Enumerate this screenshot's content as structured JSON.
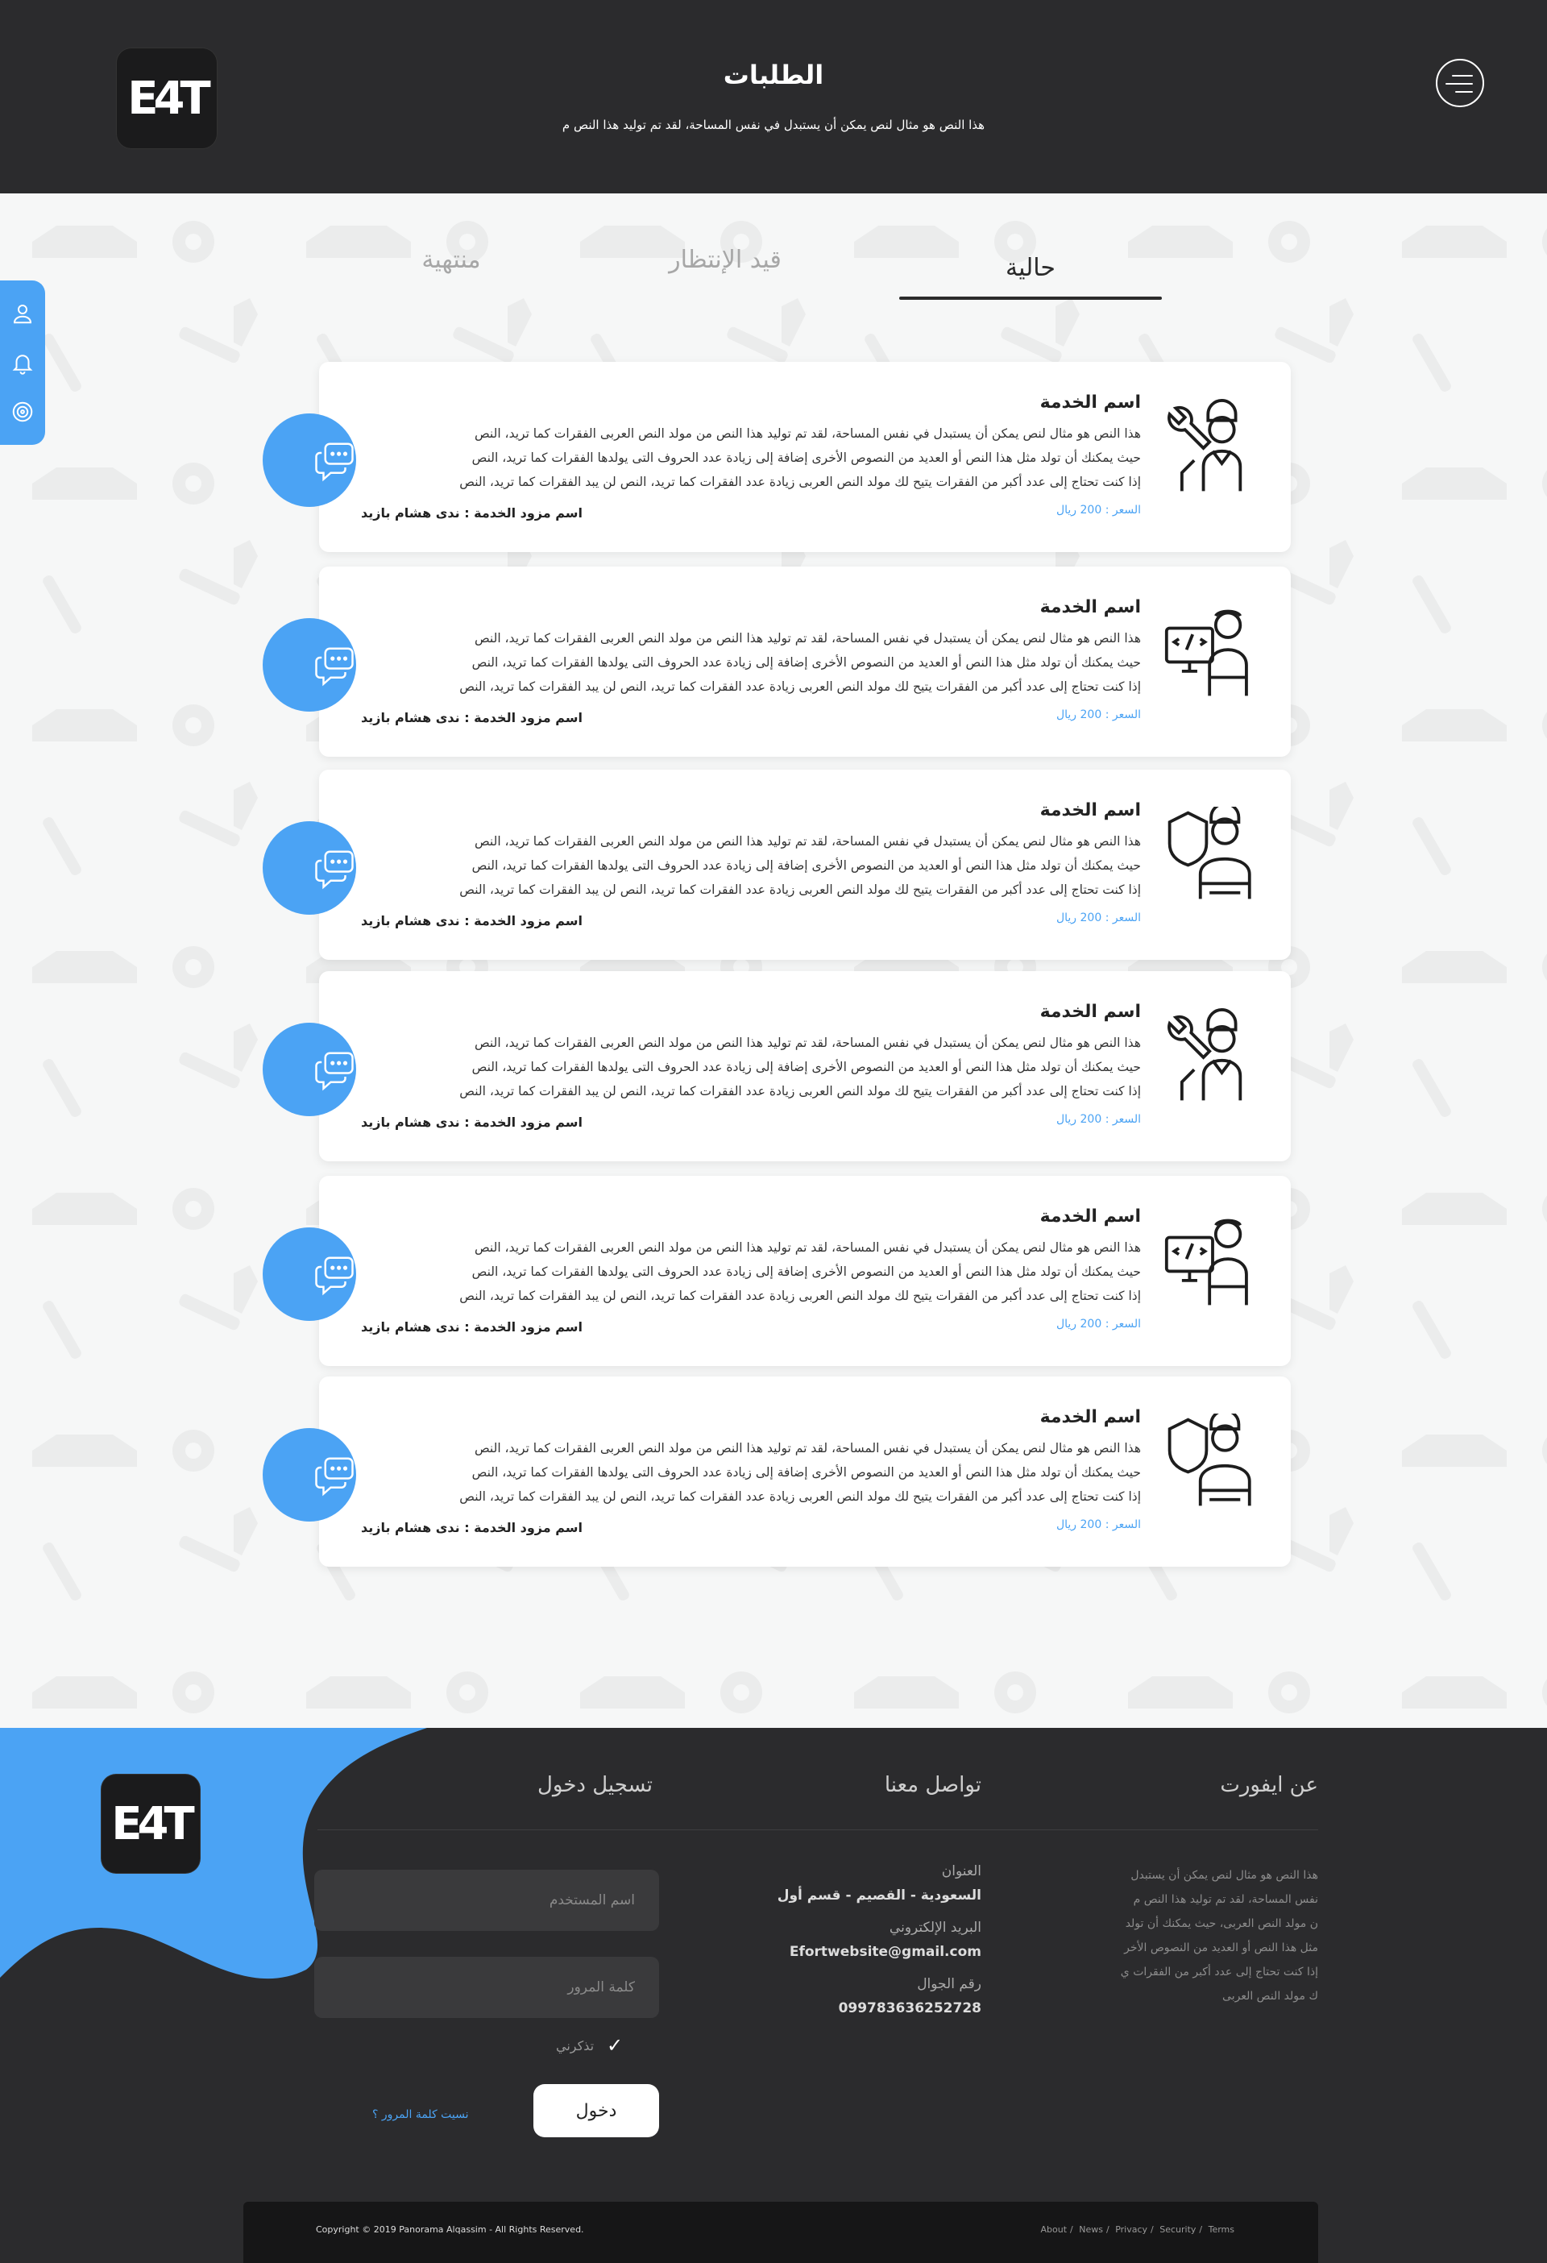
{
  "header": {
    "logo": "E4T",
    "title": "الطلبات",
    "subtitle": "هذا النص هو مثال لنص يمكن أن يستبدل في نفس المساحة، لقد تم توليد هذا النص م"
  },
  "tabs": {
    "current": "حالية",
    "pending": "قيد الإنتظار",
    "finished": "منتهية"
  },
  "orders": [
    {
      "service_name": "اسم الخدمة",
      "desc_1": "هذا النص هو مثال لنص يمكن أن يستبدل في نفس المساحة، لقد تم توليد هذا النص من مولد النص العربى  الفقرات كما تريد، النص",
      "desc_2": "حيث يمكنك أن تولد مثل هذا النص أو العديد من النصوص الأخرى إضافة إلى زيادة عدد الحروف التى يولدها  الفقرات كما تريد، النص",
      "desc_3": "إذا كنت تحتاج إلى عدد أكبر من الفقرات يتيح لك مولد النص العربى زيادة عدد الفقرات كما تريد، النص لن يبد  الفقرات كما تريد، النص",
      "price": "السعر : 200 ريال",
      "provider": "اسم مزود الخدمة : ندى هشام بازيد",
      "icon": "mechanic-icon"
    },
    {
      "service_name": "اسم الخدمة",
      "desc_1": "هذا النص هو مثال لنص يمكن أن يستبدل في نفس المساحة، لقد تم توليد هذا النص من مولد النص العربى  الفقرات كما تريد، النص",
      "desc_2": "حيث يمكنك أن تولد مثل هذا النص أو العديد من النصوص الأخرى إضافة إلى زيادة عدد الحروف التى يولدها  الفقرات كما تريد، النص",
      "desc_3": "إذا كنت تحتاج إلى عدد أكبر من الفقرات يتيح لك مولد النص العربى زيادة عدد الفقرات كما تريد، النص لن يبد  الفقرات كما تريد، النص",
      "price": "السعر : 200 ريال",
      "provider": "اسم مزود الخدمة : ندى هشام بازيد",
      "icon": "programmer-icon"
    },
    {
      "service_name": "اسم الخدمة",
      "desc_1": "هذا النص هو مثال لنص يمكن أن يستبدل في نفس المساحة، لقد تم توليد هذا النص من مولد النص العربى  الفقرات كما تريد، النص",
      "desc_2": "حيث يمكنك أن تولد مثل هذا النص أو العديد من النصوص الأخرى إضافة إلى زيادة عدد الحروف التى يولدها  الفقرات كما تريد، النص",
      "desc_3": "إذا كنت تحتاج إلى عدد أكبر من الفقرات يتيح لك مولد النص العربى زيادة عدد الفقرات كما تريد، النص لن يبد  الفقرات كما تريد، النص",
      "price": "السعر : 200 ريال",
      "provider": "اسم مزود الخدمة : ندى هشام بازيد",
      "icon": "security-worker-icon"
    },
    {
      "service_name": "اسم الخدمة",
      "desc_1": "هذا النص هو مثال لنص يمكن أن يستبدل في نفس المساحة، لقد تم توليد هذا النص من مولد النص العربى  الفقرات كما تريد، النص",
      "desc_2": "حيث يمكنك أن تولد مثل هذا النص أو العديد من النصوص الأخرى إضافة إلى زيادة عدد الحروف التى يولدها  الفقرات كما تريد، النص",
      "desc_3": "إذا كنت تحتاج إلى عدد أكبر من الفقرات يتيح لك مولد النص العربى زيادة عدد الفقرات كما تريد، النص لن يبد  الفقرات كما تريد، النص",
      "price": "السعر : 200 ريال",
      "provider": "اسم مزود الخدمة : ندى هشام بازيد",
      "icon": "mechanic-icon"
    },
    {
      "service_name": "اسم الخدمة",
      "desc_1": "هذا النص هو مثال لنص يمكن أن يستبدل في نفس المساحة، لقد تم توليد هذا النص من مولد النص العربى  الفقرات كما تريد، النص",
      "desc_2": "حيث يمكنك أن تولد مثل هذا النص أو العديد من النصوص الأخرى إضافة إلى زيادة عدد الحروف التى يولدها  الفقرات كما تريد، النص",
      "desc_3": "إذا كنت تحتاج إلى عدد أكبر من الفقرات يتيح لك مولد النص العربى زيادة عدد الفقرات كما تريد، النص لن يبد  الفقرات كما تريد، النص",
      "price": "السعر : 200 ريال",
      "provider": "اسم مزود الخدمة : ندى هشام بازيد",
      "icon": "programmer-icon"
    },
    {
      "service_name": "اسم الخدمة",
      "desc_1": "هذا النص هو مثال لنص يمكن أن يستبدل في نفس المساحة، لقد تم توليد هذا النص من مولد النص العربى  الفقرات كما تريد، النص",
      "desc_2": "حيث يمكنك أن تولد مثل هذا النص أو العديد من النصوص الأخرى إضافة إلى زيادة عدد الحروف التى يولدها  الفقرات كما تريد، النص",
      "desc_3": "إذا كنت تحتاج إلى عدد أكبر من الفقرات يتيح لك مولد النص العربى زيادة عدد الفقرات كما تريد، النص لن يبد  الفقرات كما تريد، النص",
      "price": "السعر : 200 ريال",
      "provider": "اسم مزود الخدمة : ندى هشام بازيد",
      "icon": "security-worker-icon"
    }
  ],
  "footer": {
    "logo": "E4T",
    "about": {
      "title": "عن ايفورت",
      "line_1": "هذا النص هو مثال لنص يمكن أن يستبدل",
      "line_2": "نفس المساحة، لقد تم توليد هذا النص م",
      "line_3": "ن مولد النص العربى، حيث يمكنك أن تولد",
      "line_4": "مثل هذا النص أو العديد من النصوص الأخر",
      "line_5": "إذا كنت تحتاج إلى عدد أكبر من الفقرات ي",
      "line_6": "ك مولد النص العربى"
    },
    "contact": {
      "title": "تواصل معنا",
      "address_label": "العنوان",
      "address": "السعودية - القصيم - قسم أول",
      "email_label": "البريد الإلكتروني",
      "email": "Efortwebsite@gmail.com",
      "phone_label": "رقم الجوال",
      "phone": "099783636252728"
    },
    "login": {
      "title": "تسجيل دخول",
      "username_placeholder": "اسم المستخدم",
      "password_placeholder": "كلمة المرور",
      "remember": "تذكرني",
      "submit": "دخول",
      "forgot": "نسيت كلمة المرور ؟"
    },
    "copyright": "Copyright © 2019  Panorama Alqassim -  All Rights Reserved.",
    "links": [
      "About",
      "News",
      "Privacy",
      "Security",
      "Terms"
    ]
  },
  "colors": {
    "accent": "#4ba3f4",
    "dark": "#2b2b2d"
  }
}
